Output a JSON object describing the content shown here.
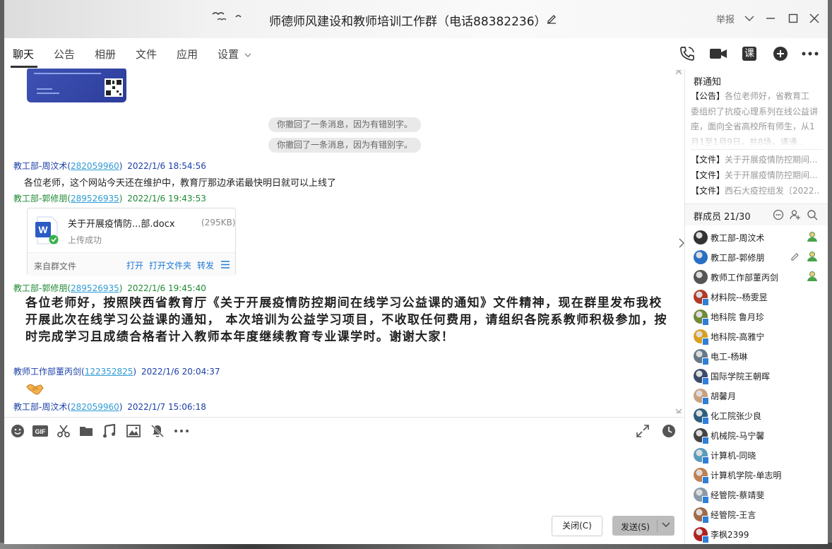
{
  "window": {
    "title": "师德师风建设和教师培训工作群（电话88382236）",
    "report_label": "举报"
  },
  "tabs": [
    {
      "label": "聊天",
      "active": true
    },
    {
      "label": "公告"
    },
    {
      "label": "相册"
    },
    {
      "label": "文件"
    },
    {
      "label": "应用"
    },
    {
      "label": "设置"
    }
  ],
  "header_tools": {
    "class_label": "课"
  },
  "chat": {
    "recall_notices": [
      "你撤回了一条消息，因为有错别字。",
      "你撤回了一条消息，因为有错别字。"
    ],
    "messages": [
      {
        "sender": "教工部-周汶术",
        "qq": "282059960",
        "time": "2022/1/6 18:54:56",
        "text": "各位老师，这个网站今天还在维护中，教育厅那边承诺最快明日就可以上线了",
        "color": "#1a3fa8"
      },
      {
        "sender": "教工部-郭修朋",
        "qq": "289526935",
        "time": "2022/1/6 19:43:53",
        "color": "#1e8a34"
      },
      {
        "sender": "教工部-郭修朋",
        "qq": "289526935",
        "time": "2022/1/6 19:45:40",
        "text": "各位老师好，按照陕西省教育厅《关于开展疫情防控期间在线学习公益课的通知》文件精神，现在群里发布我校开展此次在线学习公益课的通知， 本次培训为公益学习项目，不收取任何费用，请组织各院系教师积极参加，按时完成学习且成绩合格者计入教师本年度继续教育专业课学时。谢谢大家！",
        "color": "#1e8a34"
      },
      {
        "sender": "教师工作部董丙剑",
        "qq": "122352825",
        "time": "2022/1/6 20:04:37",
        "color": "#1a3fa8"
      },
      {
        "sender": "教工部-周汶术",
        "qq": "282059960",
        "time": "2022/1/7 15:06:18",
        "color": "#1a3fa8"
      }
    ],
    "file": {
      "name": "关于开展疫情防...部.docx",
      "size": "(295KB)",
      "status": "上传成功",
      "source": "来自群文件",
      "actions": [
        "打开",
        "打开文件夹",
        "转发"
      ]
    }
  },
  "buttons": {
    "close": "关闭(C)",
    "send": "发送(S)"
  },
  "sidebar": {
    "notice_title": "群通知",
    "notice_tag": "【公告】",
    "notice_text": "各位老师好，省教育工委组织了抗疫心理系列在线公益讲座，面向全省高校所有师生，从1月1至1月9日，共8场，请通...",
    "files": [
      {
        "tag": "【文件】",
        "text": "关于开展疫情防控期间..."
      },
      {
        "tag": "【文件】",
        "text": "关于开展疫情防控期间..."
      },
      {
        "tag": "【文件】",
        "text": "西石大疫控组发〔2022..."
      }
    ],
    "members_title": "群成员 21/30",
    "members": [
      {
        "name": "教工部-周汶术",
        "avatar": "#333333",
        "badge": true
      },
      {
        "name": "教工部-郭修朋",
        "avatar": "#2a6fc4",
        "badge": true,
        "edit": true
      },
      {
        "name": "教师工作部董丙剑",
        "avatar": "#555555",
        "badge": true
      },
      {
        "name": "材料院--杨雯昱",
        "avatar": "#b23a2a"
      },
      {
        "name": "地科院 鲁月珍",
        "avatar": "#6e8a3a"
      },
      {
        "name": "地科院-高雅宁",
        "avatar": "#d9a020"
      },
      {
        "name": "电工-杨琳",
        "avatar": "#667788"
      },
      {
        "name": "国际学院王朝晖",
        "avatar": "#3b4a6b"
      },
      {
        "name": "胡馨月",
        "avatar": "#c9a080"
      },
      {
        "name": "化工院张少良",
        "avatar": "#2e5e7e"
      },
      {
        "name": "机械院-马宁馨",
        "avatar": "#444444"
      },
      {
        "name": "计算机-同晓",
        "avatar": "#5a9bbd"
      },
      {
        "name": "计算机学院-单志明",
        "avatar": "#c08050"
      },
      {
        "name": "经管院-蔡靖斐",
        "avatar": "#8a9aa8"
      },
      {
        "name": "经管院-王言",
        "avatar": "#a06a4a"
      },
      {
        "name": "李枫2399",
        "avatar": "#b02020"
      }
    ]
  },
  "colors": {
    "link": "#1f7ad6",
    "qq_link": "#2f9bd5",
    "recall_bg": "#e9e9e9",
    "send_button": "#bcbcbc"
  }
}
